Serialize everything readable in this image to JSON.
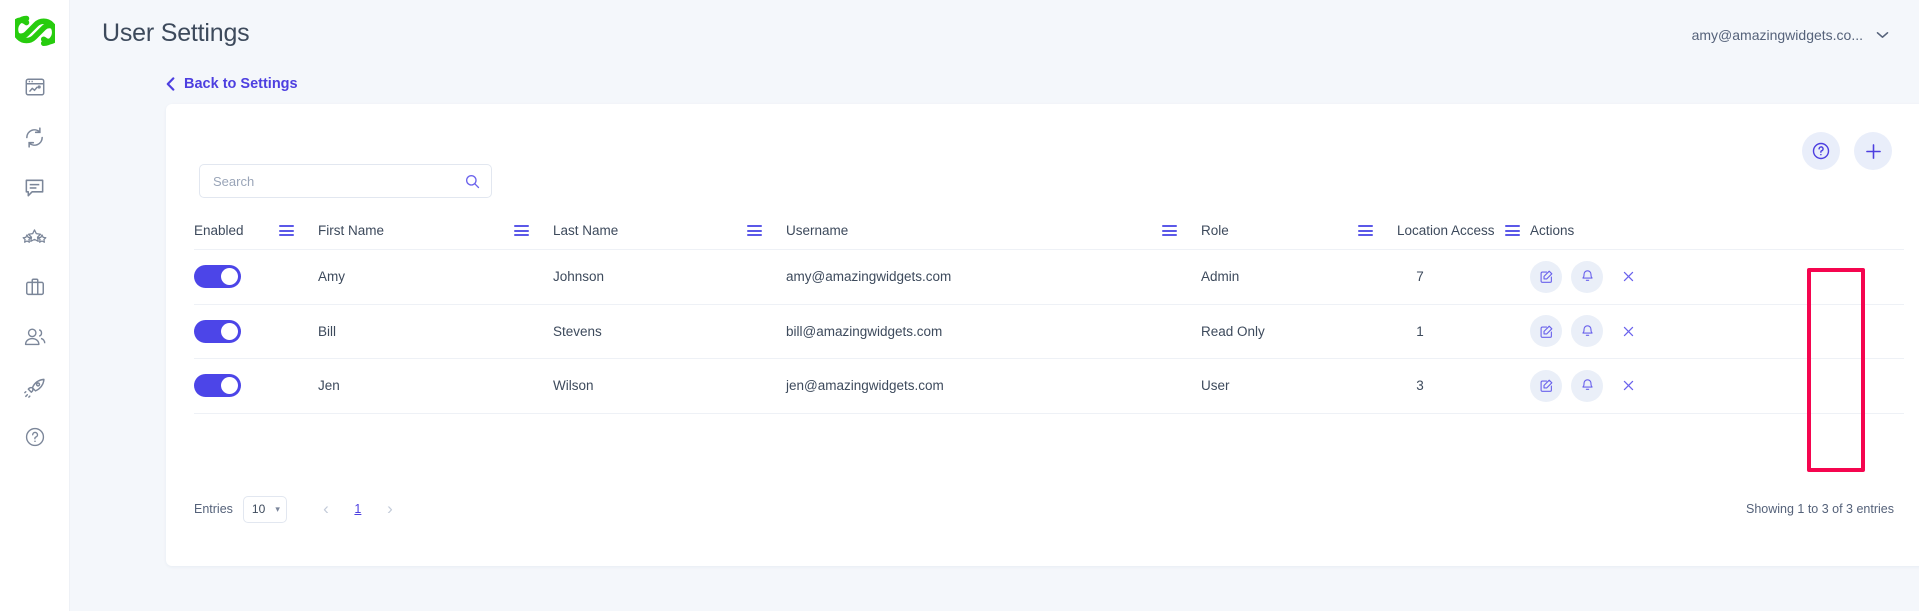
{
  "brand": {
    "logo_name": "infinity-loop-logo",
    "logo_color": "#27cc0e",
    "accent": "#4d3fe0",
    "toggle_on_color": "#4c45e8",
    "highlight_color": "#f5054f"
  },
  "sidebar": {
    "items": [
      {
        "name": "dashboard-icon",
        "label": "Dashboard"
      },
      {
        "name": "sync-icon",
        "label": "Sync"
      },
      {
        "name": "messages-icon",
        "label": "Messages"
      },
      {
        "name": "reviews-icon",
        "label": "Reviews"
      },
      {
        "name": "briefcase-icon",
        "label": "Business"
      },
      {
        "name": "users-icon",
        "label": "Users"
      },
      {
        "name": "rocket-icon",
        "label": "Boost"
      },
      {
        "name": "help-circle-icon",
        "label": "Help"
      }
    ]
  },
  "header": {
    "title": "User Settings",
    "back_link": "Back to Settings",
    "back_chevron": "‹",
    "account_email": "amy@amazingwidgets.co...",
    "account_caret": "⌄"
  },
  "card": {
    "tools": [
      {
        "name": "help-button",
        "glyph": "?"
      },
      {
        "name": "add-user-button",
        "glyph": "+"
      }
    ],
    "search": {
      "value": "",
      "placeholder": "Search",
      "icon": "search-icon"
    }
  },
  "table": {
    "columns": [
      {
        "key": "enabled",
        "label": "Enabled",
        "grip": true
      },
      {
        "key": "first",
        "label": "First Name",
        "grip": true
      },
      {
        "key": "last",
        "label": "Last Name",
        "grip": true
      },
      {
        "key": "username",
        "label": "Username",
        "grip": true
      },
      {
        "key": "role",
        "label": "Role",
        "grip": true
      },
      {
        "key": "location",
        "label": "Location Access",
        "grip": true
      },
      {
        "key": "actions",
        "label": "Actions",
        "grip": false
      }
    ],
    "rows": [
      {
        "enabled": true,
        "first": "Amy",
        "last": "Johnson",
        "username": "amy@amazingwidgets.com",
        "role": "Admin",
        "location": "7"
      },
      {
        "enabled": true,
        "first": "Bill",
        "last": "Stevens",
        "username": "bill@amazingwidgets.com",
        "role": "Read Only",
        "location": "1"
      },
      {
        "enabled": true,
        "first": "Jen",
        "last": "Wilson",
        "username": "jen@amazingwidgets.com",
        "role": "User",
        "location": "3"
      }
    ],
    "row_actions": [
      {
        "name": "edit-user-icon",
        "style": "filled"
      },
      {
        "name": "notify-user-icon",
        "style": "filled"
      },
      {
        "name": "delete-user-icon",
        "style": "plain"
      }
    ]
  },
  "footer": {
    "entries_label": "Entries",
    "entries_value": "10",
    "entries_caret": "⌄",
    "prev_glyph": "‹",
    "next_glyph": "›",
    "current_page": "1",
    "showing": "Showing 1 to 3 of 3 entries"
  }
}
